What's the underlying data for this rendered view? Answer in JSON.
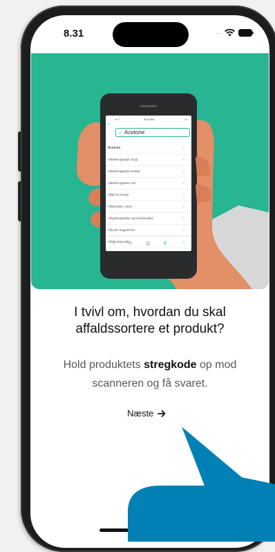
{
  "status_bar": {
    "time": "8.31"
  },
  "hero": {
    "mini_phone": {
      "status_time": "9:41 AM",
      "search_value": "Acetone",
      "list_items": [
        "Acetone",
        "Afdækningspapir, brugt",
        "Afdækningsplast, beskidt",
        "Afdækningsplast, rent",
        "Affald fra husdyr",
        "Affaldsstativ, metal",
        "Affugtningsudstyr (med kølemiddel)",
        "Affyrede fragpatroner",
        "Afkalkningsmidler"
      ]
    }
  },
  "onboarding": {
    "title_line1": "I tvivl om, hvordan du skal",
    "title_line2": "affaldssortere et produkt?",
    "subtitle_pre": "Hold produktets ",
    "subtitle_bold": "stregkode",
    "subtitle_post": " op mod scanneren og få svaret.",
    "next_label": "Næste"
  },
  "colors": {
    "accent": "#27b592",
    "callout": "#0080b5",
    "skin": "#e38f67"
  }
}
